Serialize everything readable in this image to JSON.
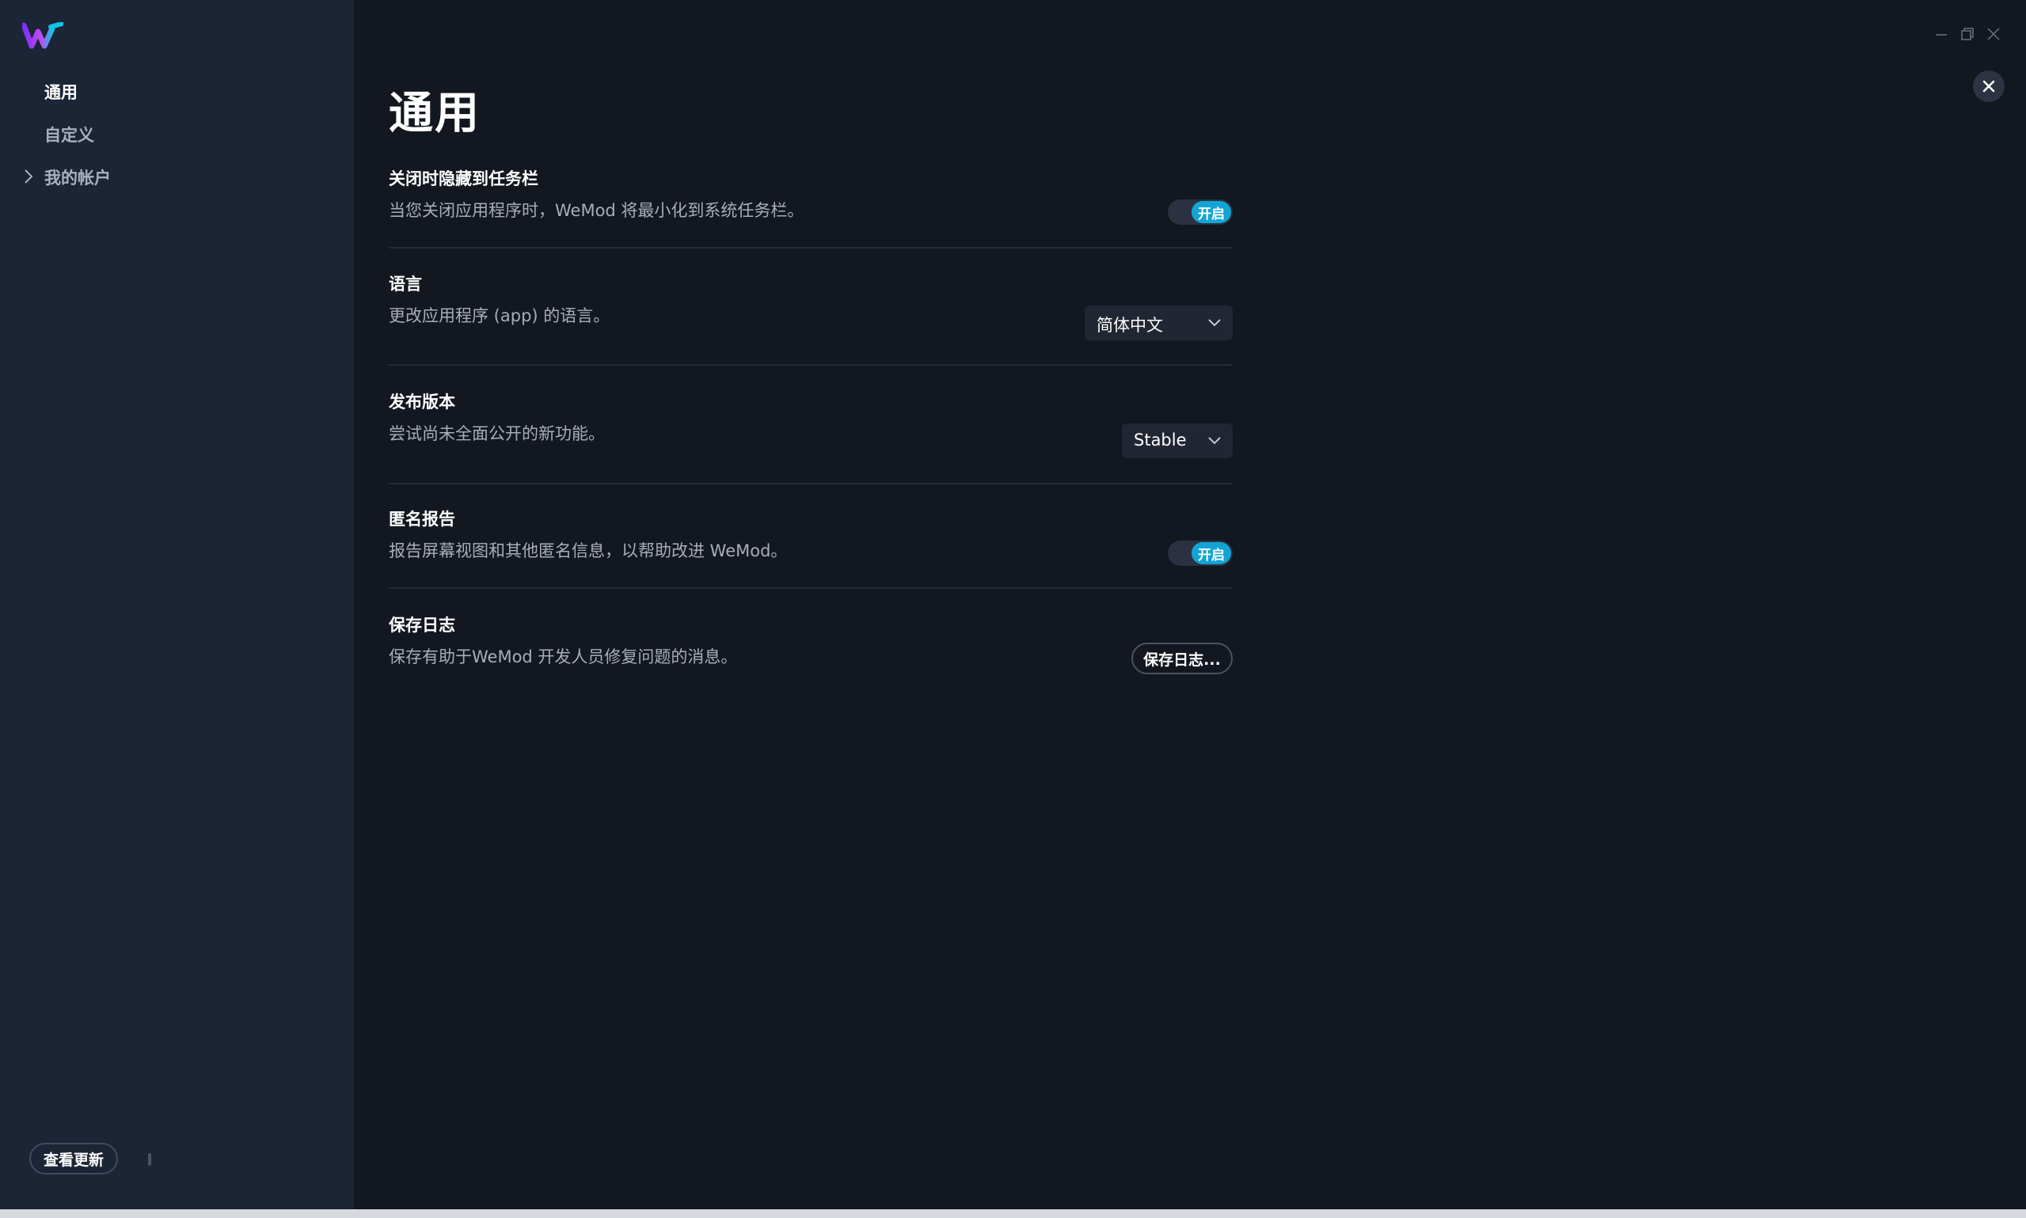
{
  "app": {
    "brand_colors": {
      "primary": "#7b2ff7",
      "secondary": "#13a4d6"
    },
    "accent": "#13a4d6"
  },
  "sidebar": {
    "items": [
      {
        "label": "通用",
        "active": true
      },
      {
        "label": "自定义",
        "active": false
      },
      {
        "label": "我的帐户",
        "active": false,
        "expandable": true
      }
    ],
    "update_button": "查看更新"
  },
  "window_controls": {
    "icons": [
      "minimize-icon",
      "restore-icon",
      "close-icon"
    ]
  },
  "page": {
    "title": "通用"
  },
  "settings": {
    "minimize_to_tray": {
      "title": "关闭时隐藏到任务栏",
      "desc": "当您关闭应用程序时，WeMod 将最小化到系统任务栏。",
      "toggle_label": "开启",
      "enabled": true
    },
    "language": {
      "title": "语言",
      "desc": "更改应用程序 (app) 的语言。",
      "value": "简体中文"
    },
    "release_channel": {
      "title": "发布版本",
      "desc": "尝试尚未全面公开的新功能。",
      "value": "Stable"
    },
    "anonymous_reporting": {
      "title": "匿名报告",
      "desc": "报告屏幕视图和其他匿名信息，以帮助改进 WeMod。",
      "toggle_label": "开启",
      "enabled": true
    },
    "save_logs": {
      "title": "保存日志",
      "desc": "保存有助于WeMod 开发人员修复问题的消息。",
      "button": "保存日志..."
    }
  }
}
